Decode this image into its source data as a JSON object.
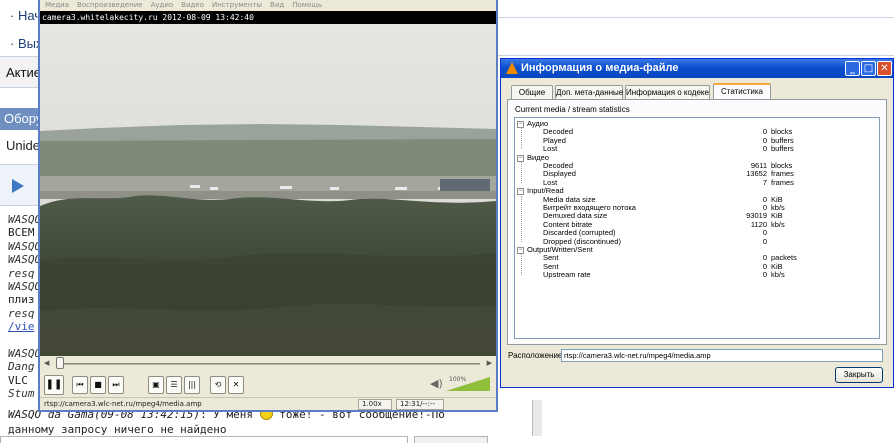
{
  "background_page": {
    "nav": [
      "· Нач",
      "· Вых"
    ],
    "active_label": "Актие",
    "equipment_label": "Обору",
    "under_label": "Unider",
    "chat_lines": [
      {
        "text": "WASQO",
        "style": "it"
      },
      {
        "text": "ВСЕМ",
        "style": ""
      },
      {
        "text": "WASQO",
        "style": "it"
      },
      {
        "text": "WASQO",
        "style": "it"
      },
      {
        "text": "resq",
        "style": "it"
      },
      {
        "text": "WASQO",
        "style": "it"
      },
      {
        "text": "плиз",
        "style": ""
      },
      {
        "text": "resq",
        "style": "it"
      },
      {
        "text": "/vie",
        "style": "lk"
      },
      {
        "text": "",
        "style": ""
      },
      {
        "text": "WASQO",
        "style": "it"
      },
      {
        "text": "Dang",
        "style": "it"
      },
      {
        "text": "VLC",
        "style": ""
      },
      {
        "text": "Stum",
        "style": "it"
      }
    ],
    "bottom_message": {
      "author": "WASQO da Gama(09-08 13:42:15)",
      "text_before": ": У меня ",
      "text_after": " тоже! - вот сообщение!-По",
      "line2": "данному запросу ничего не найдено"
    }
  },
  "vlc": {
    "menu": [
      "Медиа",
      "Воспроизведение",
      "Аудио",
      "Видео",
      "Инструменты",
      "Вид",
      "Помощь"
    ],
    "osd_text": "camera3.whitelakecity.ru 2012-08-09 13:42:40",
    "status_url": "rtsp://camera3.wlc-net.ru/mpeg4/media.amp",
    "speed": "1.00x",
    "time": "12:31/--:--",
    "volume_label": "100%",
    "volume_level": 1.0,
    "seek_position": 0.0
  },
  "info_dialog": {
    "title": "Информация о медиа-файле",
    "tabs": [
      "Общие",
      "Доп. мета-данные",
      "Информация о кодеке",
      "Статистика"
    ],
    "active_tab": 3,
    "panel_heading": "Current media / stream statistics",
    "groups": [
      {
        "name": "Аудио",
        "items": [
          {
            "label": "Decoded",
            "value": "0",
            "unit": "blocks"
          },
          {
            "label": "Played",
            "value": "0",
            "unit": "buffers"
          },
          {
            "label": "Lost",
            "value": "0",
            "unit": "buffers"
          }
        ]
      },
      {
        "name": "Видео",
        "items": [
          {
            "label": "Decoded",
            "value": "9611",
            "unit": "blocks"
          },
          {
            "label": "Displayed",
            "value": "13652",
            "unit": "frames"
          },
          {
            "label": "Lost",
            "value": "7",
            "unit": "frames"
          }
        ]
      },
      {
        "name": "Input/Read",
        "items": [
          {
            "label": "Media data size",
            "value": "0",
            "unit": "KiB"
          },
          {
            "label": "Битрейт входящего потока",
            "value": "0",
            "unit": "kb/s"
          },
          {
            "label": "Demuxed data size",
            "value": "93019",
            "unit": "KiB"
          },
          {
            "label": "Content bitrate",
            "value": "1120",
            "unit": "kb/s"
          },
          {
            "label": "Discarded (corrupted)",
            "value": "0",
            "unit": ""
          },
          {
            "label": "Dropped (discontinued)",
            "value": "0",
            "unit": ""
          }
        ]
      },
      {
        "name": "Output/Written/Sent",
        "items": [
          {
            "label": "Sent",
            "value": "0",
            "unit": "packets"
          },
          {
            "label": "Sent",
            "value": "0",
            "unit": "KiB"
          },
          {
            "label": "Upstream rate",
            "value": "0",
            "unit": "kb/s"
          }
        ]
      }
    ],
    "location_label": "Расположение:",
    "location_value": "rtsp://camera3.wlc-net.ru/mpeg4/media.amp",
    "close_label": "Закрыть"
  }
}
